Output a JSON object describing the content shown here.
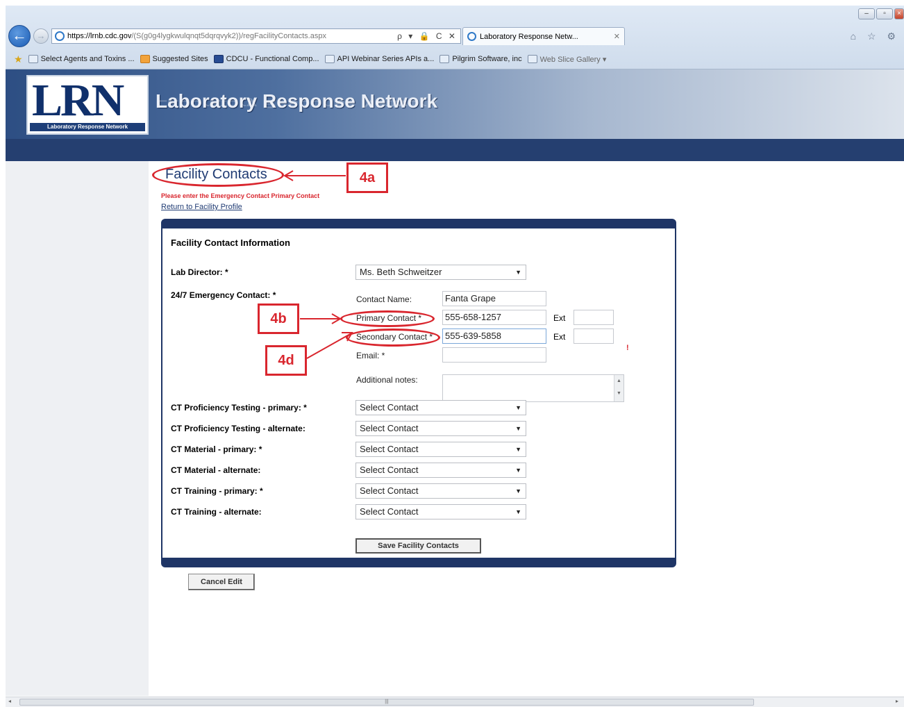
{
  "browser": {
    "url_host": "https://lrnb.cdc.gov",
    "url_path": "/(S(g0g4lygkwulqnqt5dqrqvyk2))/regFacilityContacts.aspx",
    "address_tools": "ρ ▾ 🔒 C ✕",
    "tab_title": "Laboratory Response Netw...",
    "tab_close": "✕",
    "toolbar_icons": "⌂ ☆ ⚙",
    "favorites": [
      {
        "label": "Select Agents and Toxins ...",
        "icon": "ie-page-icon"
      },
      {
        "label": "Suggested Sites",
        "icon": "suggested-sites-icon"
      },
      {
        "label": "CDCU - Functional Comp...",
        "icon": "cdc-icon"
      },
      {
        "label": "API Webinar Series APIs a...",
        "icon": "api-icon"
      },
      {
        "label": "Pilgrim Software, inc",
        "icon": "pilgrim-icon"
      },
      {
        "label": "Web Slice Gallery ▾",
        "icon": "web-slice-icon"
      }
    ]
  },
  "header": {
    "logo_text": "LRN",
    "logo_sub": "Laboratory Response Network",
    "site_title": "Laboratory Response Network"
  },
  "page": {
    "heading": "Facility Contacts",
    "warning": "Please enter the Emergency Contact Primary Contact",
    "return_link": "Return to Facility Profile"
  },
  "form": {
    "section_title": "Facility Contact Information",
    "lab_director_label": "Lab Director: *",
    "lab_director_value": "Ms. Beth Schweitzer",
    "emergency_label": "24/7 Emergency Contact: *",
    "contact_name_label": "Contact Name:",
    "contact_name_value": "Fanta Grape",
    "primary_contact_label": "Primary Contact *",
    "primary_contact_value": "555-658-1257",
    "secondary_contact_label": "Secondary Contact *",
    "secondary_contact_value": "555-639-5858",
    "ext_label": "Ext",
    "email_label": "Email: *",
    "notes_label": "Additional notes:",
    "required_mark": "!",
    "dropdown_arrow": "▼",
    "ct_rows": [
      {
        "label": "CT Proficiency Testing - primary: *",
        "value": "Select Contact"
      },
      {
        "label": "CT Proficiency Testing - alternate:",
        "value": "Select Contact"
      },
      {
        "label": "CT Material - primary: *",
        "value": "Select Contact"
      },
      {
        "label": "CT Material - alternate:",
        "value": "Select Contact"
      },
      {
        "label": "CT Training - primary: *",
        "value": "Select Contact"
      },
      {
        "label": "CT Training - alternate:",
        "value": "Select Contact"
      }
    ],
    "save_button": "Save Facility Contacts",
    "cancel_button": "Cancel Edit"
  },
  "annotations": {
    "a4a": "4a",
    "a4b": "4b",
    "a4d": "4d",
    "color": "#d9262e"
  },
  "colors": {
    "nav_bar": "#253f70",
    "panel_border": "#1f3566",
    "heading": "#1f3b73"
  }
}
